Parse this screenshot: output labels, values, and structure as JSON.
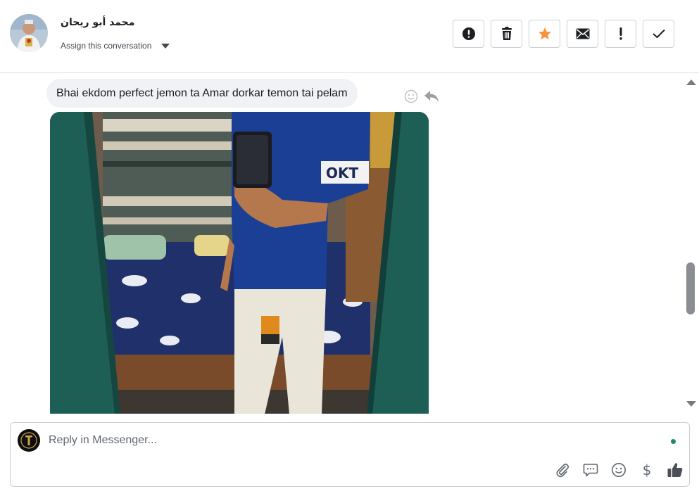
{
  "header": {
    "contact_name": "محمد أبو ريحان",
    "assign_label": "Assign this conversation",
    "toolbar": [
      {
        "name": "spam-button",
        "icon": "exclamation-circle-icon"
      },
      {
        "name": "delete-button",
        "icon": "trash-icon"
      },
      {
        "name": "star-button",
        "icon": "star-icon"
      },
      {
        "name": "mark-unread-button",
        "icon": "envelope-icon"
      },
      {
        "name": "follow-up-button",
        "icon": "exclamation-icon"
      },
      {
        "name": "mark-done-button",
        "icon": "checkmark-icon"
      }
    ]
  },
  "messages": [
    {
      "type": "text",
      "text": "Bhai ekdom perfect jemon ta Amar dorkar temon tai pelam"
    },
    {
      "type": "image",
      "shirt_text": "OKT"
    }
  ],
  "composer": {
    "placeholder": "Reply in Messenger...",
    "actions": [
      "paperclip-icon",
      "chat-bubble-icon",
      "smiley-icon",
      "dollar-icon",
      "thumbs-up-icon"
    ],
    "dollar_symbol": "$"
  },
  "colors": {
    "accent_star": "#f7923a",
    "online": "#1e8a6e",
    "bubble": "#f0f2f5",
    "border": "#ccd0d5"
  }
}
